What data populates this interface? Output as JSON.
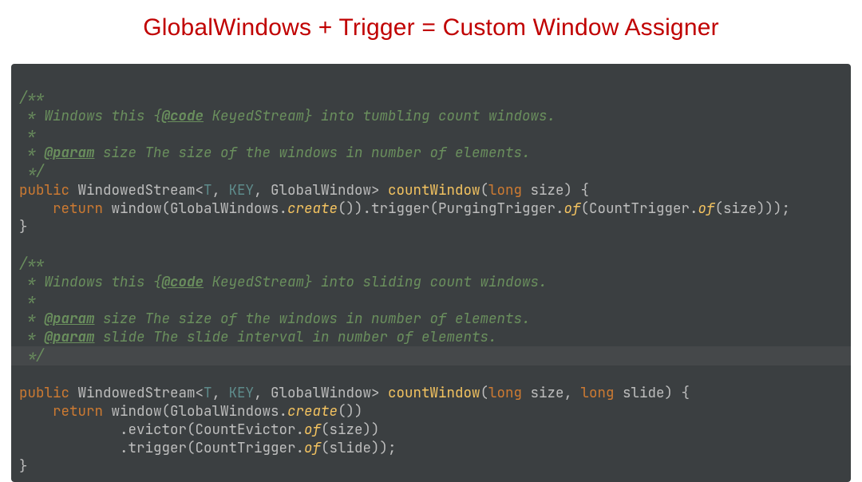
{
  "title": "GlobalWindows + Trigger = Custom Window Assigner",
  "code": {
    "doc1_l1": "/**",
    "doc1_l2_pre": " * Windows this {",
    "doc1_l2_tag": "@code",
    "doc1_l2_post": " KeyedStream} into tumbling count windows.",
    "doc1_l3": " *",
    "doc1_l4_pre": " * ",
    "doc1_l4_tag": "@param",
    "doc1_l4_post": " size The size of the windows in number of elements.",
    "doc1_l5": " */",
    "m1_public": "public",
    "m1_type": " WindowedStream<",
    "m1_gen": "T",
    "m1_comma1": ", ",
    "m1_key": "KEY",
    "m1_comma2": ", ",
    "m1_gw": "GlobalWindow",
    "m1_close": "> ",
    "m1_name": "countWindow",
    "m1_open_paren": "(",
    "m1_long": "long",
    "m1_size": " size) {",
    "m1_body_ind": "    ",
    "m1_return": "return",
    "m1_body_rest1": " window(GlobalWindows.",
    "m1_create": "create",
    "m1_body_rest2": "()).trigger(PurgingTrigger.",
    "m1_of1": "of",
    "m1_body_rest3": "(CountTrigger.",
    "m1_of2": "of",
    "m1_body_rest4": "(size)));",
    "m1_close_brace": "}",
    "blank": "",
    "doc2_l1": "/**",
    "doc2_l2_pre": " * Windows this {",
    "doc2_l2_tag": "@code",
    "doc2_l2_post": " KeyedStream} into sliding count windows.",
    "doc2_l3": " *",
    "doc2_l4_pre": " * ",
    "doc2_l4_tag": "@param",
    "doc2_l4_post": " size The size of the windows in number of elements.",
    "doc2_l5_pre": " * ",
    "doc2_l5_tag": "@param",
    "doc2_l5_post": " slide The slide interval in number of elements.",
    "doc2_l6": " */",
    "m2_public": "public",
    "m2_type": " WindowedStream<",
    "m2_gen": "T",
    "m2_comma1": ", ",
    "m2_key": "KEY",
    "m2_comma2": ", ",
    "m2_gw": "GlobalWindow",
    "m2_close": "> ",
    "m2_name": "countWindow",
    "m2_open_paren": "(",
    "m2_long1": "long",
    "m2_size": " size, ",
    "m2_long2": "long",
    "m2_slide": " slide) {",
    "m2_body_ind": "    ",
    "m2_return": "return",
    "m2_body1": " window(GlobalWindows.",
    "m2_create": "create",
    "m2_body1b": "())",
    "m2_body2_ind": "            .evictor(CountEvictor.",
    "m2_of1": "of",
    "m2_body2b": "(size))",
    "m2_body3_ind": "            .trigger(CountTrigger.",
    "m2_of2": "of",
    "m2_body3b": "(slide));",
    "m2_close_brace": "}"
  }
}
